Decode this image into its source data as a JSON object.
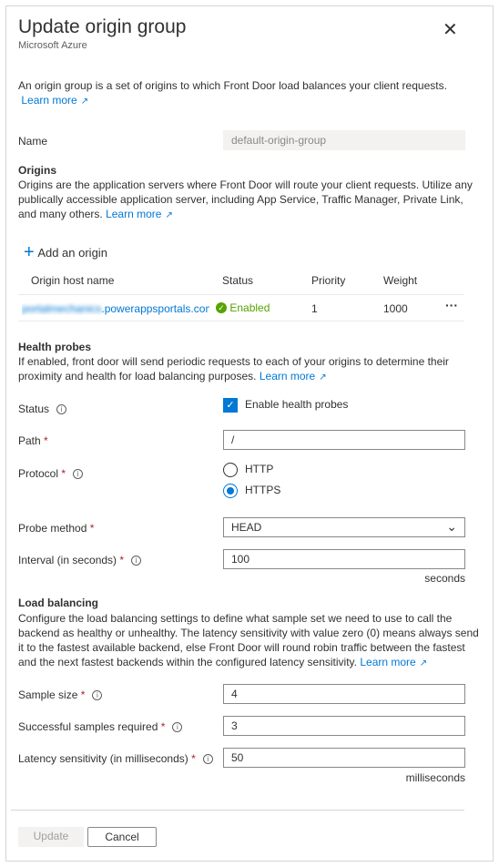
{
  "header": {
    "title": "Update origin group",
    "subtitle": "Microsoft Azure",
    "close_icon": "close-icon"
  },
  "intro": {
    "text": "An origin group is a set of origins to which Front Door load balances your client requests.",
    "learn_more": "Learn more"
  },
  "name": {
    "label": "Name",
    "value": "default-origin-group"
  },
  "origins": {
    "heading": "Origins",
    "description": "Origins are the application servers where Front Door will route your client requests. Utilize any publically accessible application server, including App Service, Traffic Manager, Private Link, and many others.",
    "learn_more": "Learn more",
    "add_label": "Add an origin",
    "columns": [
      "Origin host name",
      "Status",
      "Priority",
      "Weight"
    ],
    "rows": [
      {
        "host_blurred": "portalmechanics",
        "host_suffix": ".powerappsportals.com",
        "status": "Enabled",
        "priority": "1",
        "weight": "1000"
      }
    ],
    "status_color": "#57a300"
  },
  "health": {
    "heading": "Health probes",
    "description": "If enabled, front door will send periodic requests to each of your origins to determine their proximity and health for load balancing purposes.",
    "learn_more": "Learn more",
    "status_label": "Status",
    "enable_label": "Enable health probes",
    "enabled": true,
    "path_label": "Path",
    "path_value": "/",
    "protocol_label": "Protocol",
    "protocols": [
      "HTTP",
      "HTTPS"
    ],
    "protocol_selected": "HTTPS",
    "method_label": "Probe method",
    "method_value": "HEAD",
    "interval_label": "Interval (in seconds)",
    "interval_value": "100",
    "interval_unit": "seconds"
  },
  "lb": {
    "heading": "Load balancing",
    "description": "Configure the load balancing settings to define what sample set we need to use to call the backend as healthy or unhealthy. The latency sensitivity with value zero (0) means always send it to the fastest available backend, else Front Door will round robin traffic between the fastest and the next fastest backends within the configured latency sensitivity.",
    "learn_more": "Learn more",
    "sample_label": "Sample size",
    "sample_value": "4",
    "success_label": "Successful samples required",
    "success_value": "3",
    "latency_label": "Latency sensitivity (in milliseconds)",
    "latency_value": "50",
    "latency_unit": "milliseconds"
  },
  "footer": {
    "update": "Update",
    "cancel": "Cancel"
  },
  "accent": "#0078d4"
}
